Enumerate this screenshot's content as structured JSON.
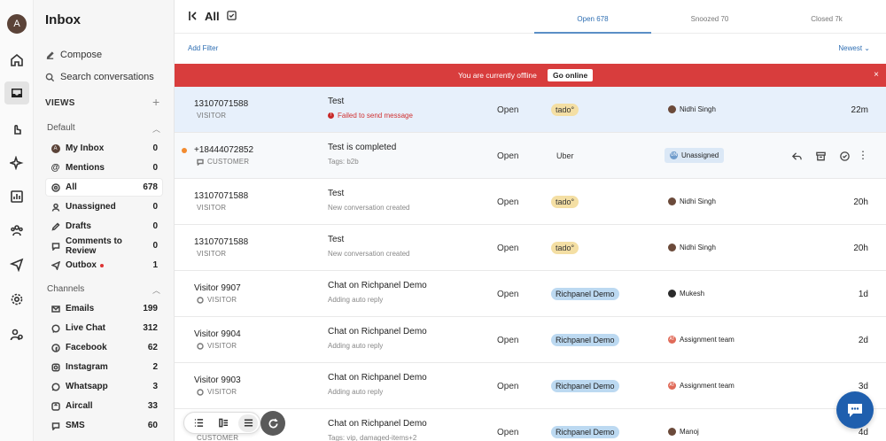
{
  "rail": {
    "avatar_initial": "A"
  },
  "sidebar": {
    "title": "Inbox",
    "compose": "Compose",
    "search": "Search conversations",
    "views_label": "VIEWS",
    "default_label": "Default",
    "channels_label": "Channels",
    "default_items": [
      {
        "label": "My Inbox",
        "count": "0"
      },
      {
        "label": "Mentions",
        "count": "0"
      },
      {
        "label": "All",
        "count": "678"
      },
      {
        "label": "Unassigned",
        "count": "0"
      },
      {
        "label": "Drafts",
        "count": "0"
      },
      {
        "label": "Comments to Review",
        "count": "0"
      },
      {
        "label": "Outbox",
        "count": "1"
      }
    ],
    "channel_items": [
      {
        "label": "Emails",
        "count": "199"
      },
      {
        "label": "Live Chat",
        "count": "312"
      },
      {
        "label": "Facebook",
        "count": "62"
      },
      {
        "label": "Instagram",
        "count": "2"
      },
      {
        "label": "Whatsapp",
        "count": "3"
      },
      {
        "label": "Aircall",
        "count": "33"
      },
      {
        "label": "SMS",
        "count": "60"
      }
    ]
  },
  "header": {
    "title": "All",
    "tabs": [
      {
        "label": "Open 678"
      },
      {
        "label": "Snoozed 70"
      },
      {
        "label": "Closed 7k"
      }
    ],
    "add_filter": "Add Filter",
    "sort": "Newest"
  },
  "offline_banner": {
    "message": "You are currently offline",
    "button": "Go online",
    "close": "×"
  },
  "rows": [
    {
      "name": "13107071588",
      "role": "VISITOR",
      "subject": "Test",
      "sub": "Failed to send message",
      "status": "Open",
      "tag": "tado°",
      "assignee": "Nidhi Singh",
      "time": "22m"
    },
    {
      "name": "+18444072852",
      "role": "CUSTOMER",
      "subject": "Test is completed",
      "sub": "Tags: b2b",
      "status": "Open",
      "tag": "Uber",
      "assignee": "Unassigned",
      "assignee_initials": "UN",
      "time": ""
    },
    {
      "name": "13107071588",
      "role": "VISITOR",
      "subject": "Test",
      "sub": "New conversation created",
      "status": "Open",
      "tag": "tado°",
      "assignee": "Nidhi Singh",
      "time": "20h"
    },
    {
      "name": "13107071588",
      "role": "VISITOR",
      "subject": "Test",
      "sub": "New conversation created",
      "status": "Open",
      "tag": "tado°",
      "assignee": "Nidhi Singh",
      "time": "20h"
    },
    {
      "name": "Visitor 9907",
      "role": "VISITOR",
      "subject": "Chat on Richpanel Demo",
      "sub": "Adding auto reply",
      "status": "Open",
      "tag": "Richpanel Demo",
      "assignee": "Mukesh",
      "time": "1d"
    },
    {
      "name": "Visitor 9904",
      "role": "VISITOR",
      "subject": "Chat on Richpanel Demo",
      "sub": "Adding auto reply",
      "status": "Open",
      "tag": "Richpanel Demo",
      "assignee": "Assignment team",
      "assignee_initials": "AT",
      "time": "2d"
    },
    {
      "name": "Visitor 9903",
      "role": "VISITOR",
      "subject": "Chat on Richpanel Demo",
      "sub": "Adding auto reply",
      "status": "Open",
      "tag": "Richpanel Demo",
      "assignee": "Assignment team",
      "assignee_initials": "AT",
      "time": "3d"
    },
    {
      "name": "",
      "role": "CUSTOMER",
      "subject": "Chat on Richpanel Demo",
      "sub": "Tags: vip, damaged-items+2",
      "status": "Open",
      "tag": "Richpanel Demo",
      "assignee": "Manoj",
      "time": "4d"
    }
  ],
  "colors": {
    "accent": "#2f6fb3",
    "offline_red": "#d83d3d",
    "chat_fab": "#1f5fae"
  }
}
